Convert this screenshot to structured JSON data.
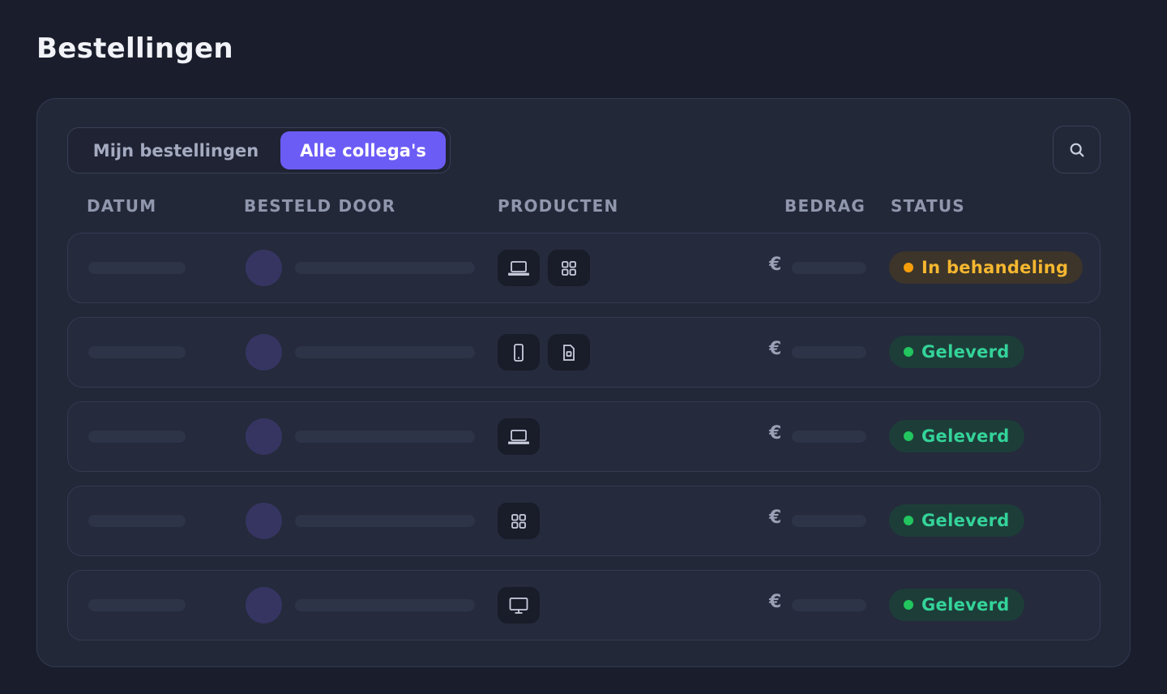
{
  "page": {
    "title": "Bestellingen"
  },
  "filter": {
    "mine_label": "Mijn bestellingen",
    "all_label": "Alle collega's",
    "active": "all"
  },
  "search": {
    "icon": "search-icon"
  },
  "table": {
    "headers": {
      "date": "DATUM",
      "ordered_by": "BESTELD DOOR",
      "products": "PRODUCTEN",
      "amount": "BEDRAG",
      "status": "STATUS"
    },
    "currency_symbol": "€",
    "rows": [
      {
        "products": [
          "laptop-icon",
          "grid-icon"
        ],
        "status": "In behandeling",
        "status_type": "pending"
      },
      {
        "products": [
          "phone-icon",
          "document-icon"
        ],
        "status": "Geleverd",
        "status_type": "delivered"
      },
      {
        "products": [
          "laptop-icon"
        ],
        "status": "Geleverd",
        "status_type": "delivered"
      },
      {
        "products": [
          "grid-icon"
        ],
        "status": "Geleverd",
        "status_type": "delivered"
      },
      {
        "products": [
          "monitor-icon"
        ],
        "status": "Geleverd",
        "status_type": "delivered"
      }
    ]
  },
  "colors": {
    "accent": "#6c5cf6",
    "pending": "#f5b730",
    "delivered": "#34d399",
    "background": "#1a1e2c",
    "card": "#232839"
  }
}
